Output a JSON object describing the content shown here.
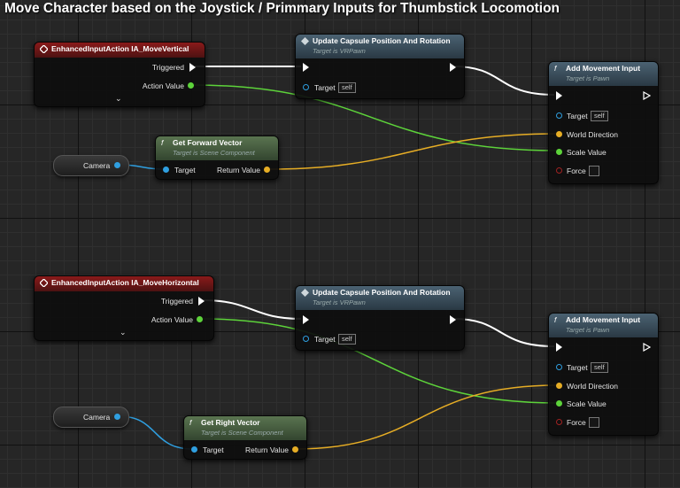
{
  "title": "Move Character based on the Joystick / Primmary Inputs for Thumbstick Locomotion",
  "colors": {
    "exec": "#ffffff",
    "float_pin": "#5dd33a",
    "object_pin": "#2f9fe0",
    "vector_pin": "#e6ad25",
    "event_header": "#8a1a1a",
    "function_header": "#4b6272",
    "pure_header": "#5a7450"
  },
  "vertical": {
    "event": {
      "title": "EnhancedInputAction IA_MoveVertical",
      "triggered": "Triggered",
      "action_value": "Action Value",
      "expand_icon": "chevron-down-icon"
    },
    "update": {
      "title": "Update Capsule Position And Rotation",
      "subtitle": "Target is VRPawn",
      "target": "Target",
      "self": "self"
    },
    "camera": {
      "label": "Camera"
    },
    "get_vector": {
      "title": "Get Forward Vector",
      "subtitle": "Target is Scene Component",
      "target": "Target",
      "return": "Return Value"
    },
    "add_movement": {
      "title": "Add Movement Input",
      "subtitle": "Target is Pawn",
      "target": "Target",
      "self": "self",
      "world_direction": "World Direction",
      "scale_value": "Scale Value",
      "force": "Force"
    }
  },
  "horizontal": {
    "event": {
      "title": "EnhancedInputAction IA_MoveHorizontal",
      "triggered": "Triggered",
      "action_value": "Action Value",
      "expand_icon": "chevron-down-icon"
    },
    "update": {
      "title": "Update Capsule Position And Rotation",
      "subtitle": "Target is VRPawn",
      "target": "Target",
      "self": "self"
    },
    "camera": {
      "label": "Camera"
    },
    "get_vector": {
      "title": "Get Right Vector",
      "subtitle": "Target is Scene Component",
      "target": "Target",
      "return": "Return Value"
    },
    "add_movement": {
      "title": "Add Movement Input",
      "subtitle": "Target is Pawn",
      "target": "Target",
      "self": "self",
      "world_direction": "World Direction",
      "scale_value": "Scale Value",
      "force": "Force"
    }
  }
}
